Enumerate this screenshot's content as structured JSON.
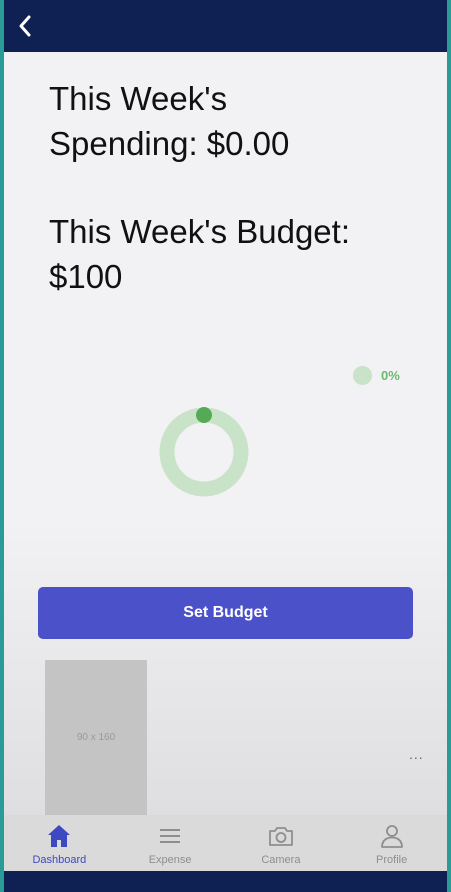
{
  "spending": {
    "label": "This Week's",
    "line2": "Spending: $0.00"
  },
  "budget": {
    "label": "This Week's Budget:",
    "line2": "$100"
  },
  "chart_data": {
    "type": "pie",
    "categories": [
      ""
    ],
    "values": [
      0
    ],
    "legend": [
      "0%"
    ],
    "colors": [
      "#c8e3c7",
      "#55aa55"
    ]
  },
  "actions": {
    "set_budget_label": "Set Budget"
  },
  "ad": {
    "placeholder_text": "90 x 160",
    "more_label": "..."
  },
  "tabs": [
    {
      "label": "Dashboard",
      "icon": "home-icon",
      "active": true
    },
    {
      "label": "Expense",
      "icon": "menu-icon",
      "active": false
    },
    {
      "label": "Camera",
      "icon": "camera-icon",
      "active": false
    },
    {
      "label": "Profile",
      "icon": "profile-icon",
      "active": false
    }
  ],
  "colors": {
    "header": "#0f2052",
    "accent": "#4b52c9",
    "active_tab": "#3d49c0",
    "donut_track": "#c8e3c7",
    "donut_marker": "#55aa55"
  }
}
